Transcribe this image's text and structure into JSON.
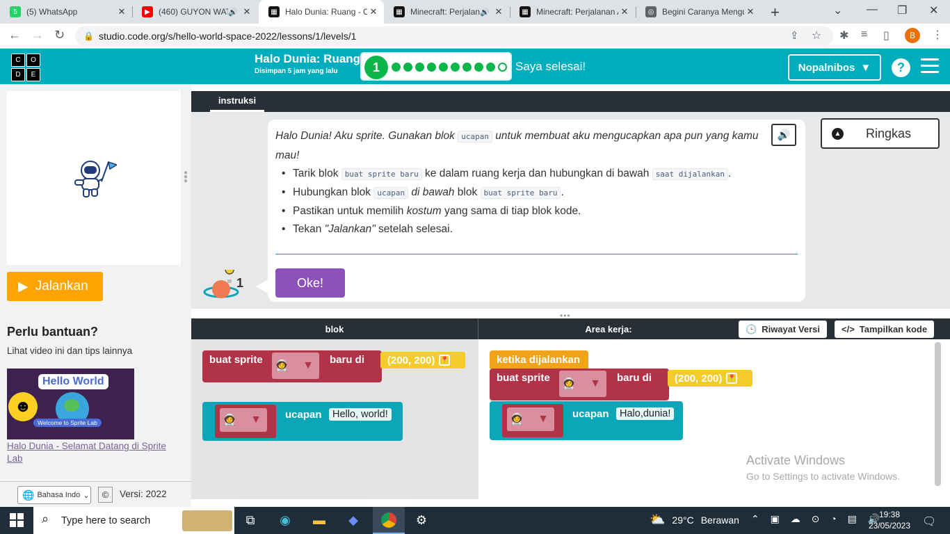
{
  "browser": {
    "tabs": [
      {
        "title": "(5) WhatsApp",
        "fav_color": "#25d366",
        "fav_glyph": "5",
        "icon": "whatsapp-icon"
      },
      {
        "title": "(460) GUYON WAT",
        "fav_color": "#ff0000",
        "fav_glyph": "▶",
        "icon": "youtube-icon",
        "audio": true
      },
      {
        "title": "Halo Dunia: Ruang - C",
        "fav_color": "#111111",
        "fav_glyph": "▦",
        "icon": "code-org-icon",
        "active": true
      },
      {
        "title": "Minecraft: Perjalan",
        "fav_color": "#111111",
        "fav_glyph": "▦",
        "icon": "code-org-icon",
        "audio": true
      },
      {
        "title": "Minecraft: Perjalanan A",
        "fav_color": "#111111",
        "fav_glyph": "▦",
        "icon": "code-org-icon"
      },
      {
        "title": "Begini Caranya Mengu",
        "fav_color": "#5f6368",
        "fav_glyph": "◎",
        "icon": "globe-icon"
      }
    ],
    "url": "studio.code.org/s/hello-world-space-2022/lessons/1/levels/1",
    "profile_initial": "B"
  },
  "header": {
    "logo_letters": [
      "C",
      "O",
      "D",
      "E"
    ],
    "title": "Halo Dunia: Ruang",
    "subtitle": "Disimpan 5 jam yang lalu",
    "level_number": "1",
    "progress_dots_filled": 9,
    "progress_dots_empty": 1,
    "finish_label": "Saya selesai!",
    "user_name": "Nopalnibos",
    "help_label": "?",
    "accent_color": "#00adbc"
  },
  "left": {
    "run_label": "Jalankan",
    "help_title": "Perlu bantuan?",
    "help_text": "Lihat video ini dan tips lainnya",
    "video_title": "Hello World",
    "video_subtitle": "Welcome to Sprite Lab",
    "video_link": "Halo Dunia - Selamat Datang di Sprite Lab",
    "language": "Bahasa Indo",
    "copyright": "©",
    "version": "Versi: 2022"
  },
  "instructions": {
    "tab_label": "instruksi",
    "intro_a": "Halo Dunia! Aku sprite. Gunakan blok ",
    "intro_code": "ucapan",
    "intro_b": " untuk membuat aku mengucapkan apa pun yang kamu mau!",
    "b1_a": "Tarik blok ",
    "b1_code1": "buat sprite baru",
    "b1_b": " ke dalam ruang kerja dan hubungkan di bawah ",
    "b1_code2": "saat dijalankan",
    "b1_c": ".",
    "b2_a": "Hubungkan blok ",
    "b2_code1": "ucapan",
    "b2_em": " di bawah",
    "b2_b": " blok ",
    "b2_code2": "buat sprite baru",
    "b2_c": ".",
    "b3_a": "Pastikan untuk memilih ",
    "b3_em": "kostum",
    "b3_b": " yang sama di tiap blok kode.",
    "b4_a": "Tekan ",
    "b4_em": "\"Jalankan\"",
    "b4_b": " setelah selesai.",
    "ok_label": "Oke!",
    "summary_label": "Ringkas",
    "hint_count": "1"
  },
  "workspace": {
    "toolbox_header": "blok",
    "area_header": "Area kerja:",
    "history_label": "Riwayat Versi",
    "show_code_label": "Tampilkan kode",
    "toolbox_blocks": {
      "make_sprite": "buat sprite",
      "new_at": "baru di",
      "position": "(200, 200)",
      "say": "ucapan",
      "say_text": "Hello, world!"
    },
    "area_blocks": {
      "when_run": "ketika dijalankan",
      "make_sprite": "buat sprite",
      "new_at": "baru di",
      "position": "(200, 200)",
      "say": "ucapan",
      "say_text": "Halo,dunia!"
    },
    "watermark_title": "Activate Windows",
    "watermark_sub": "Go to Settings to activate Windows."
  },
  "taskbar": {
    "search_placeholder": "Type here to search",
    "temperature": "29°C",
    "weather": "Berawan",
    "time": "19:38",
    "date": "23/05/2023"
  }
}
